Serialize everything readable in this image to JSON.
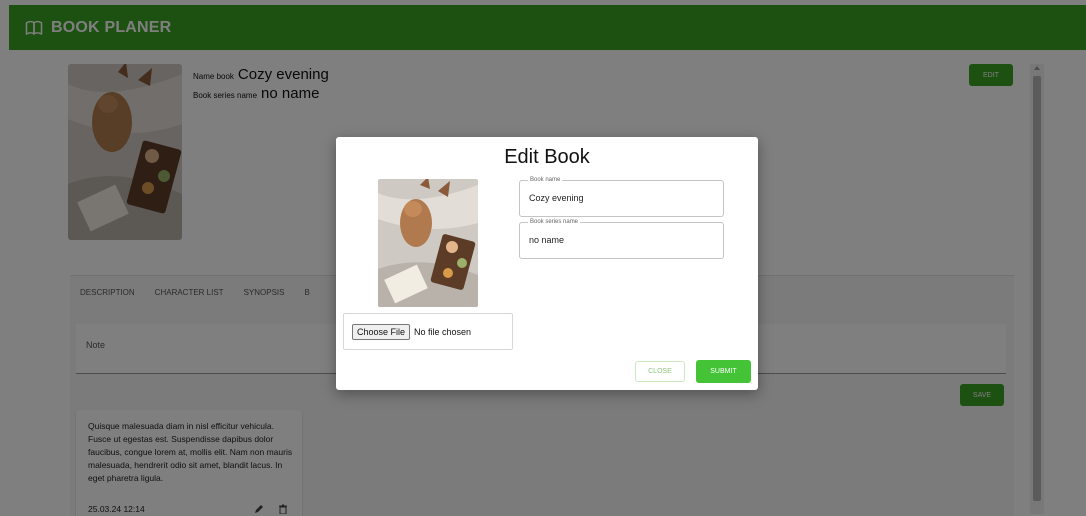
{
  "app": {
    "title": "BOOK PLANER",
    "logo_icon": "open-book-icon",
    "brand_color": "#3aa224"
  },
  "book": {
    "name_label": "Name book",
    "name_value": "Cozy evening",
    "series_label": "Book series name",
    "series_value": "no name",
    "edit_label": "EDIT"
  },
  "tabs": [
    "DESCRIPTION",
    "CHARACTER LIST",
    "SYNOPSIS",
    "B"
  ],
  "note": {
    "label": "Note",
    "save_label": "SAVE"
  },
  "note_card": {
    "text": "Quisque malesuada diam in nisl efficitur vehicula. Fusce ut egestas est. Suspendisse dapibus dolor faucibus, congue lorem at, mollis elit. Nam non mauris malesuada, hendrerit odio sit amet, blandit lacus. In eget pharetra ligula.",
    "date": "25.03.24 12:14",
    "edit_icon": "pencil-icon",
    "delete_icon": "trash-icon"
  },
  "modal": {
    "title": "Edit Book",
    "name_label": "Book name",
    "name_value": "Cozy evening",
    "series_label": "Book series name",
    "series_value": "no name",
    "file_button": "Choose File",
    "file_status": "No file chosen",
    "close_label": "CLOSE",
    "submit_label": "SUBMIT"
  }
}
